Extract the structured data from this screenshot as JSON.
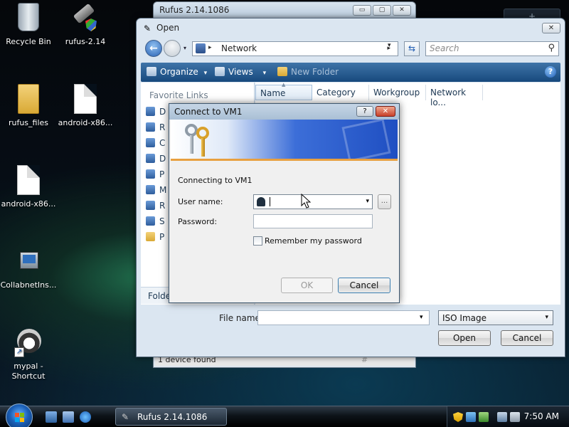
{
  "desktop": {
    "icons": [
      {
        "label": "Recycle Bin"
      },
      {
        "label": "rufus-2.14"
      },
      {
        "label": "rufus_files"
      },
      {
        "label": "android-x86..."
      },
      {
        "label": "android-x86..."
      },
      {
        "label": "CollabnetIns..."
      },
      {
        "label": "mypal - Shortcut"
      }
    ],
    "gadget_label": "+"
  },
  "rufus_window": {
    "title": "Rufus 2.14.1086",
    "minimize": "▭",
    "maximize": "▢",
    "close": "✕",
    "status": "1 device found",
    "status_sep": "#"
  },
  "open_dialog": {
    "title": "Open",
    "close": "✕",
    "address": {
      "location": "Network",
      "sep": "▸",
      "arrow": "▸",
      "drop": "▾"
    },
    "search_placeholder": "Search",
    "toolbar": {
      "organize": "Organize",
      "views": "Views",
      "new_folder": "New Folder",
      "drop": "▾",
      "help": "?"
    },
    "nav": {
      "favorite_links": "Favorite Links",
      "items": [
        "D",
        "R",
        "C",
        "D",
        "P",
        "M",
        "R",
        "S",
        "P"
      ],
      "folders": "Folde"
    },
    "columns": [
      "Name",
      "Category",
      "Workgroup",
      "Network lo..."
    ],
    "file_name_label": "File name:",
    "file_name_value": "",
    "filter": "ISO Image",
    "open_label": "Open",
    "cancel_label": "Cancel"
  },
  "connect_dialog": {
    "title": "Connect to VM1",
    "help": "?",
    "close": "✕",
    "connecting_text": "Connecting to VM1",
    "user_label": "User name:",
    "user_value": "",
    "password_label": "Password:",
    "password_value": "",
    "browse": "...",
    "remember_label": "Remember my password",
    "remember_checked": false,
    "ok_label": "OK",
    "ok_enabled": false,
    "cancel_label": "Cancel"
  },
  "taskbar": {
    "task_title": "Rufus 2.14.1086",
    "clock": "7:50 AM"
  },
  "colors": {
    "accent": "#1f5db4",
    "banner_stripe": "#e8a040",
    "close_red": "#c8402a"
  }
}
